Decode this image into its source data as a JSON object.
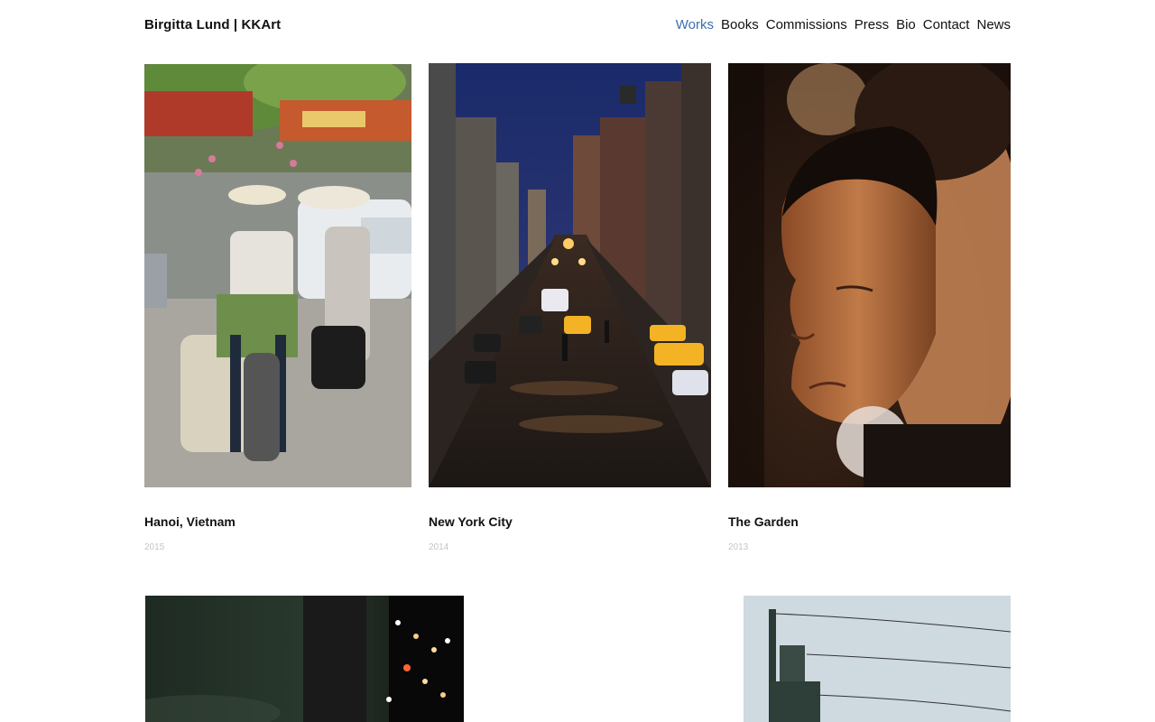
{
  "header": {
    "site_title": "Birgitta Lund  |  KKArt"
  },
  "nav": {
    "items": [
      {
        "label": "Works",
        "active": true
      },
      {
        "label": "Books"
      },
      {
        "label": "Commissions"
      },
      {
        "label": "Press"
      },
      {
        "label": "Bio"
      },
      {
        "label": "Contact"
      },
      {
        "label": "News"
      }
    ]
  },
  "works": [
    {
      "title": "Hanoi, Vietnam",
      "year": "2015"
    },
    {
      "title": "New York City",
      "year": "2014"
    },
    {
      "title": "The Garden",
      "year": "2013"
    },
    {
      "title": "",
      "year": ""
    },
    {
      "title": "",
      "year": ""
    }
  ],
  "colors": {
    "accent": "#3d6fb0",
    "year_text": "#c4c4c4"
  }
}
